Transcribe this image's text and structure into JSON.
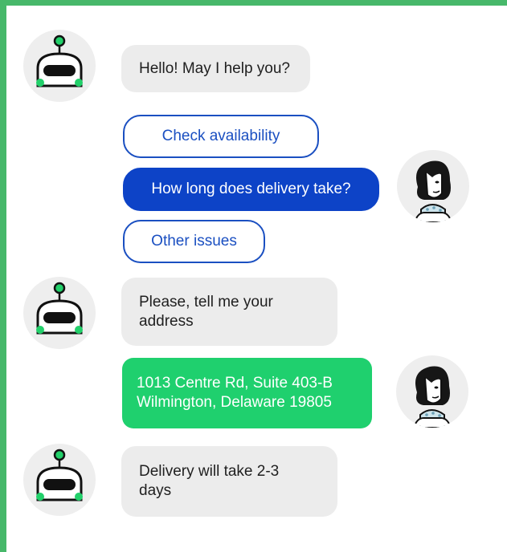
{
  "colors": {
    "frame_border": "#47b86a",
    "bot_bubble": "#ececec",
    "option_border": "#1a4fc1",
    "option_selected": "#0d43c7",
    "user_bubble": "#1fd06e"
  },
  "avatars": {
    "bot": "robot-icon",
    "user": "woman-portrait-icon"
  },
  "conversation": {
    "bot_greeting": "Hello! May I help you?",
    "options": [
      {
        "label": "Check availability",
        "selected": false
      },
      {
        "label": "How long does delivery take?",
        "selected": true
      },
      {
        "label": "Other issues",
        "selected": false
      }
    ],
    "bot_request": "Please, tell me your\naddress",
    "user_address": "1013 Centre Rd, Suite 403-B\nWilmington, Delaware 19805",
    "bot_reply": "Delivery will take 2-3\ndays"
  }
}
